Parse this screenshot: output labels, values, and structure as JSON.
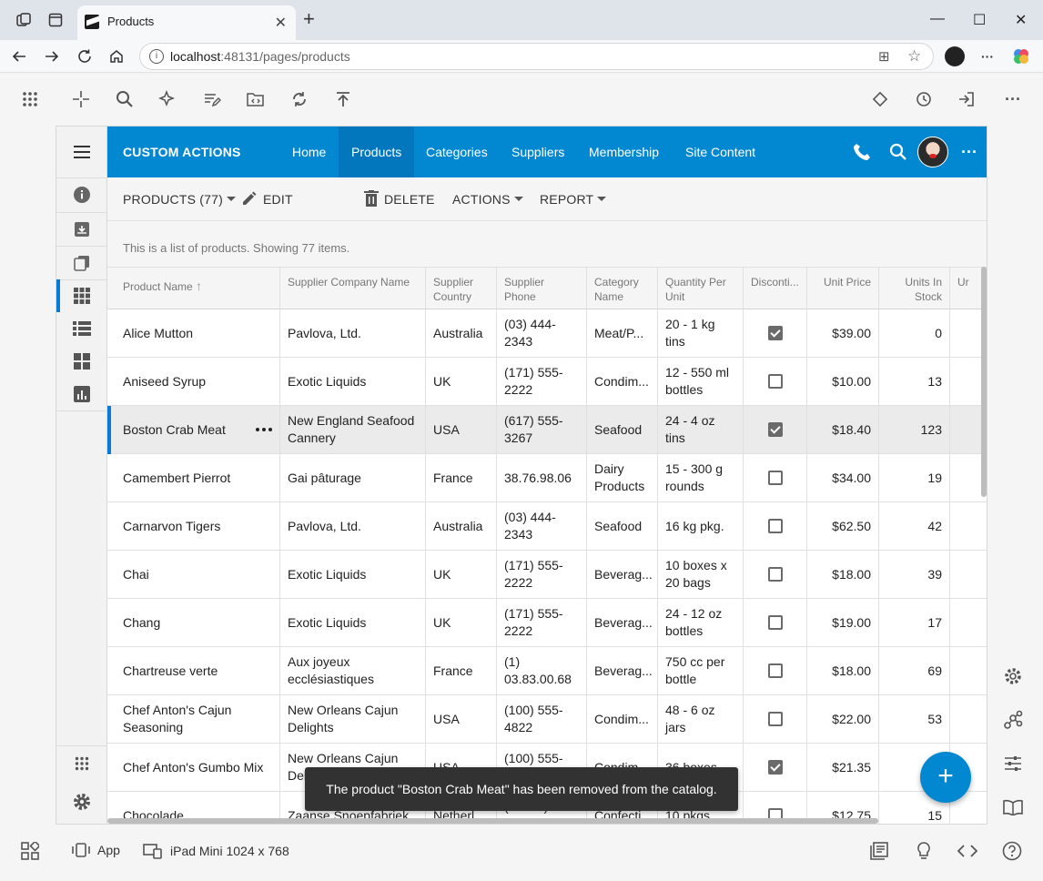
{
  "browser": {
    "tab_title": "Products",
    "url_host": "localhost",
    "url_path": ":48131/pages/products"
  },
  "app": {
    "title": "CUSTOM ACTIONS",
    "menu": [
      "Home",
      "Products",
      "Categories",
      "Suppliers",
      "Membership",
      "Site Content"
    ],
    "active_menu": "Products"
  },
  "toolbar": {
    "products_label": "PRODUCTS (77)",
    "edit_label": "EDIT",
    "delete_label": "DELETE",
    "actions_label": "ACTIONS",
    "report_label": "REPORT"
  },
  "description": "This is a list of products. Showing 77 items.",
  "grid": {
    "columns": [
      "Product Name",
      "Supplier Company Name",
      "Supplier Country",
      "Supplier Phone",
      "Category Name",
      "Quantity Per Unit",
      "Disconti...",
      "Unit Price",
      "Units In Stock",
      "Ur"
    ],
    "rows": [
      {
        "name": "Alice Mutton",
        "supplier": "Pavlova, Ltd.",
        "country": "Australia",
        "phone": "(03) 444-2343",
        "category": "Meat/P...",
        "qty": "20 - 1 kg tins",
        "disc": true,
        "price": "$39.00",
        "stock": "0"
      },
      {
        "name": "Aniseed Syrup",
        "supplier": "Exotic Liquids",
        "country": "UK",
        "phone": "(171) 555-2222",
        "category": "Condim...",
        "qty": "12 - 550 ml bottles",
        "disc": false,
        "price": "$10.00",
        "stock": "13"
      },
      {
        "name": "Boston Crab Meat",
        "supplier": "New England Seafood Cannery",
        "country": "USA",
        "phone": "(617) 555-3267",
        "category": "Seafood",
        "qty": "24 - 4 oz tins",
        "disc": true,
        "price": "$18.40",
        "stock": "123"
      },
      {
        "name": "Camembert Pierrot",
        "supplier": "Gai pâturage",
        "country": "France",
        "phone": "38.76.98.06",
        "category": "Dairy Products",
        "qty": "15 - 300 g rounds",
        "disc": false,
        "price": "$34.00",
        "stock": "19"
      },
      {
        "name": "Carnarvon Tigers",
        "supplier": "Pavlova, Ltd.",
        "country": "Australia",
        "phone": "(03) 444-2343",
        "category": "Seafood",
        "qty": "16 kg pkg.",
        "disc": false,
        "price": "$62.50",
        "stock": "42"
      },
      {
        "name": "Chai",
        "supplier": "Exotic Liquids",
        "country": "UK",
        "phone": "(171) 555-2222",
        "category": "Beverag...",
        "qty": "10 boxes x 20 bags",
        "disc": false,
        "price": "$18.00",
        "stock": "39"
      },
      {
        "name": "Chang",
        "supplier": "Exotic Liquids",
        "country": "UK",
        "phone": "(171) 555-2222",
        "category": "Beverag...",
        "qty": "24 - 12 oz bottles",
        "disc": false,
        "price": "$19.00",
        "stock": "17"
      },
      {
        "name": "Chartreuse verte",
        "supplier": "Aux joyeux ecclésiastiques",
        "country": "France",
        "phone": "(1) 03.83.00.68",
        "category": "Beverag...",
        "qty": "750 cc per bottle",
        "disc": false,
        "price": "$18.00",
        "stock": "69"
      },
      {
        "name": "Chef Anton's Cajun Seasoning",
        "supplier": "New Orleans Cajun Delights",
        "country": "USA",
        "phone": "(100) 555-4822",
        "category": "Condim...",
        "qty": "48 - 6 oz jars",
        "disc": false,
        "price": "$22.00",
        "stock": "53"
      },
      {
        "name": "Chef Anton's Gumbo Mix",
        "supplier": "New Orleans Cajun Delights",
        "country": "USA",
        "phone": "(100) 555-4822",
        "category": "Condim...",
        "qty": "36 boxes",
        "disc": true,
        "price": "$21.35",
        "stock": "0"
      },
      {
        "name": "Chocolade",
        "supplier": "Zaanse Snoepfabriek",
        "country": "Netherl...",
        "phone": "(12345) 1212",
        "category": "Confecti...",
        "qty": "10 pkgs.",
        "disc": false,
        "price": "$12.75",
        "stock": "15"
      }
    ]
  },
  "snackbar": "The product \"Boston Crab Meat\" has been removed from the catalog.",
  "fab_label": "+",
  "bottombar": {
    "app_label": "App",
    "device_label": "iPad Mini 1024 x 768"
  },
  "colors": {
    "accent": "#0288d1",
    "accent_dark": "#0277bd",
    "selection_bar": "#0a7ad2"
  }
}
